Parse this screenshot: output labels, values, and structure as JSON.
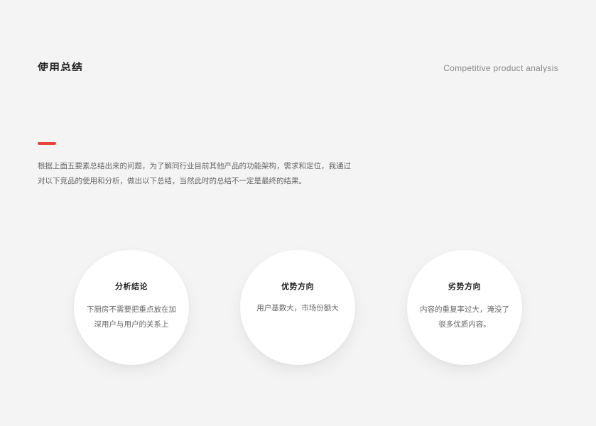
{
  "header": {
    "title": "使用总结",
    "subtitle": "Competitive product analysis"
  },
  "intro": {
    "lines": [
      "根据上面五要素总结出来的问题，为了解同行业目前其他产品的功能架构，需求和定位，我通过",
      "对以下竞品的使用和分析，做出以下总结，当然此时的总结不一定是最终的结果。"
    ]
  },
  "cards": [
    {
      "title": "分析结论",
      "lines": [
        "下厨房不需要把重点放在加",
        "深用户与用户的关系上"
      ]
    },
    {
      "title": "优势方向",
      "lines": [
        "用户基数大，市场份额大"
      ]
    },
    {
      "title": "劣势方向",
      "lines": [
        "内容的重复率过大，淹没了",
        "很多优质内容。"
      ]
    }
  ],
  "colors": {
    "accent": "#e8423a",
    "background": "#f4f4f4",
    "card": "#ffffff"
  }
}
